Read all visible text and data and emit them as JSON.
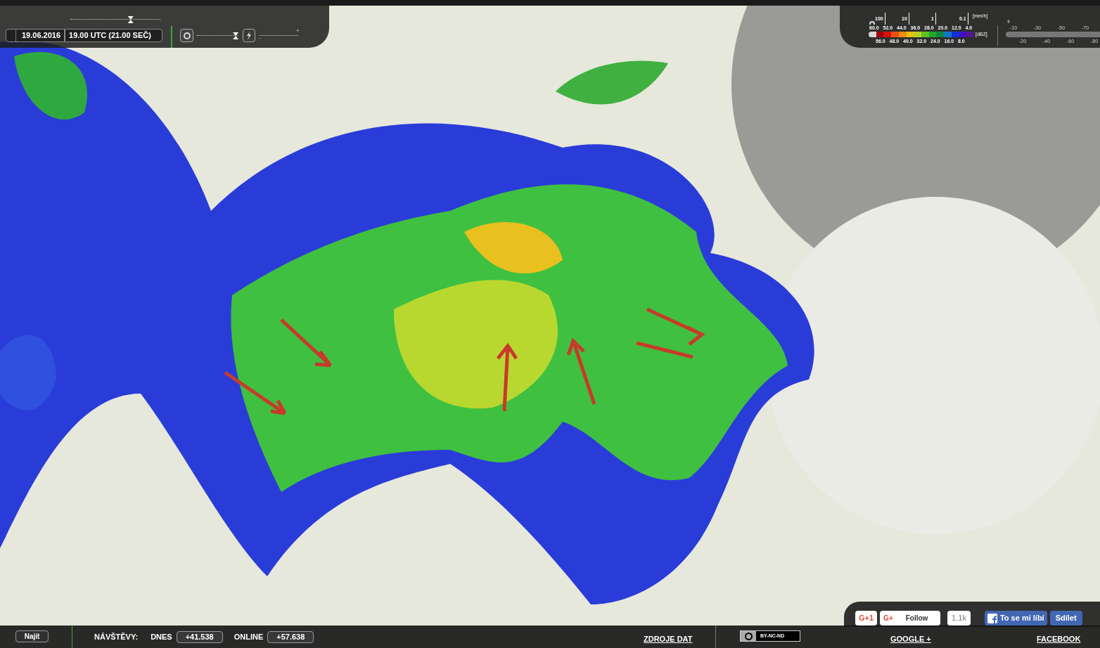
{
  "time_panel": {
    "date": "19.06.2016",
    "time": "19.00 UTC (21.00 SEČ)",
    "timeline_slider": {
      "level": 0.67
    },
    "opacity_slider": {
      "level": 0.95
    },
    "lightning_slider": {
      "minus": "-",
      "plus": "+"
    }
  },
  "rain_legend": {
    "rate_ticks": [
      "100",
      "10",
      "1",
      "0.1"
    ],
    "rate_unit": "[mm/h]",
    "top_labels": [
      "60.0",
      "52.0",
      "44.0",
      "36.0",
      "28.0",
      "20.0",
      "12.0",
      "4.0"
    ],
    "bottom_labels": [
      "56.0",
      "48.0",
      "40.0",
      "32.0",
      "24.0",
      "16.0",
      "8.0"
    ],
    "unit": "[dBZ]",
    "swatches": [
      {
        "color": "#d8d8d8"
      },
      {
        "color": "#a00010"
      },
      {
        "color": "#d81010"
      },
      {
        "color": "#e85010"
      },
      {
        "color": "#f08c10"
      },
      {
        "color": "#e8c010"
      },
      {
        "color": "#b8d020"
      },
      {
        "color": "#60c020"
      },
      {
        "color": "#20a830"
      },
      {
        "color": "#108840"
      },
      {
        "color": "#1078c0"
      },
      {
        "color": "#1030e0"
      },
      {
        "color": "#4010c0"
      },
      {
        "color": "#501890"
      }
    ]
  },
  "lightning_legend": {
    "top_labels": [
      "-10",
      "-30",
      "-50",
      "-70"
    ],
    "bottom_labels": [
      "-20",
      "-40",
      "-60",
      "-80"
    ]
  },
  "social": {
    "gplus_one": "G+1",
    "follow_icon": "G+",
    "follow": "Follow",
    "follow_count": "1.1k",
    "like": "To se mi líbí",
    "share": "Sdílet"
  },
  "bottom_bar": {
    "search_button": "Najít",
    "visits_label": "NÁVŠTĚVY:",
    "today_label": "DNES",
    "today_count": "+41.538",
    "online_label": "ONLINE",
    "online_count": "+57.638",
    "data_sources_link": "ZDROJE DAT",
    "license": "BY-NC-ND",
    "google_link": "GOOGLE +",
    "facebook_link": "FACEBOOK"
  }
}
